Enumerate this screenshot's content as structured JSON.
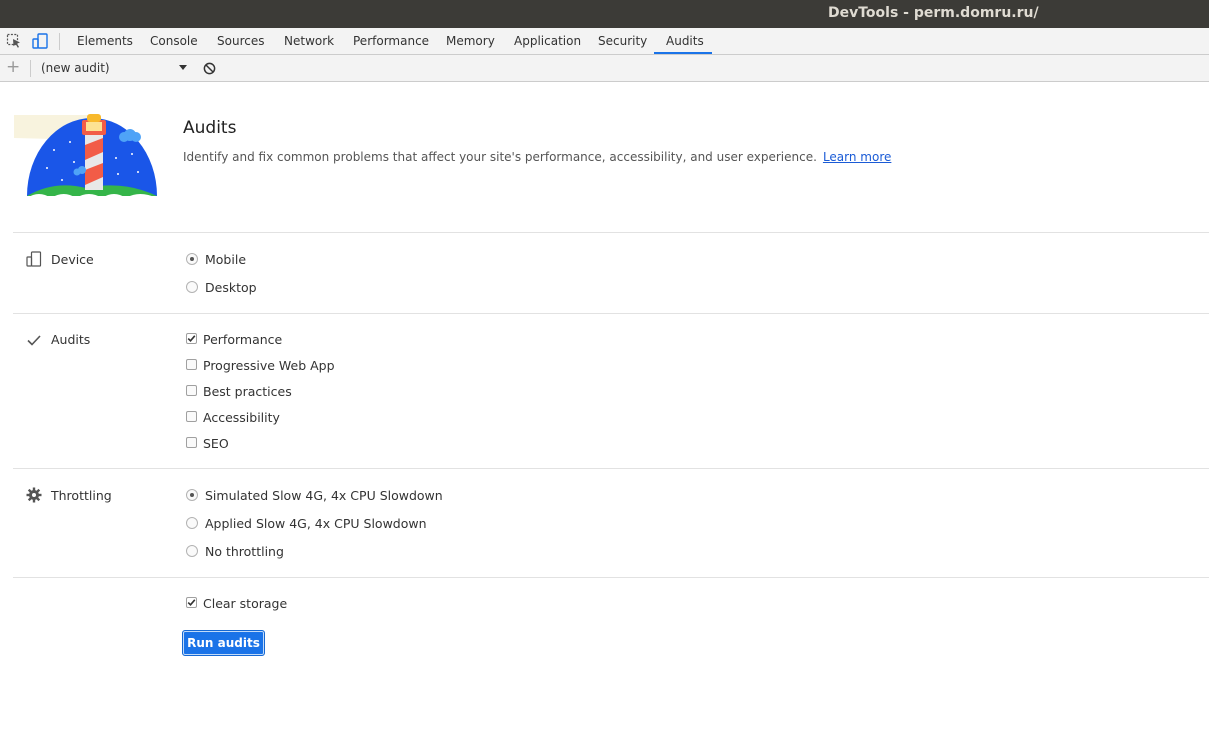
{
  "window": {
    "title": "DevTools - perm.domru.ru/"
  },
  "tabs": [
    {
      "label": "Elements"
    },
    {
      "label": "Console"
    },
    {
      "label": "Sources"
    },
    {
      "label": "Network"
    },
    {
      "label": "Performance"
    },
    {
      "label": "Memory"
    },
    {
      "label": "Application"
    },
    {
      "label": "Security"
    },
    {
      "label": "Audits",
      "active": true
    }
  ],
  "toolbar": {
    "new_audit_button": "+",
    "audit_select": "(new audit)"
  },
  "header": {
    "title": "Audits",
    "description": "Identify and fix common problems that affect your site's performance, accessibility, and user experience.",
    "learn_more": "Learn more"
  },
  "sections": {
    "device": {
      "label": "Device",
      "options": [
        {
          "label": "Mobile",
          "checked": true
        },
        {
          "label": "Desktop",
          "checked": false
        }
      ]
    },
    "audits": {
      "label": "Audits",
      "options": [
        {
          "label": "Performance",
          "checked": true
        },
        {
          "label": "Progressive Web App",
          "checked": false
        },
        {
          "label": "Best practices",
          "checked": false
        },
        {
          "label": "Accessibility",
          "checked": false
        },
        {
          "label": "SEO",
          "checked": false
        }
      ]
    },
    "throttling": {
      "label": "Throttling",
      "options": [
        {
          "label": "Simulated Slow 4G, 4x CPU Slowdown",
          "checked": true
        },
        {
          "label": "Applied Slow 4G, 4x CPU Slowdown",
          "checked": false
        },
        {
          "label": "No throttling",
          "checked": false
        }
      ]
    }
  },
  "clear_storage": {
    "label": "Clear storage",
    "checked": true
  },
  "run_button": {
    "label": "Run audits"
  },
  "colors": {
    "accent": "#1a73e8",
    "titlebar": "#3c3b37"
  },
  "icons": [
    "inspect-element-icon",
    "device-toggle-icon",
    "clear-icon",
    "device-icon",
    "checkmark-icon",
    "gear-icon",
    "lighthouse-logo"
  ]
}
